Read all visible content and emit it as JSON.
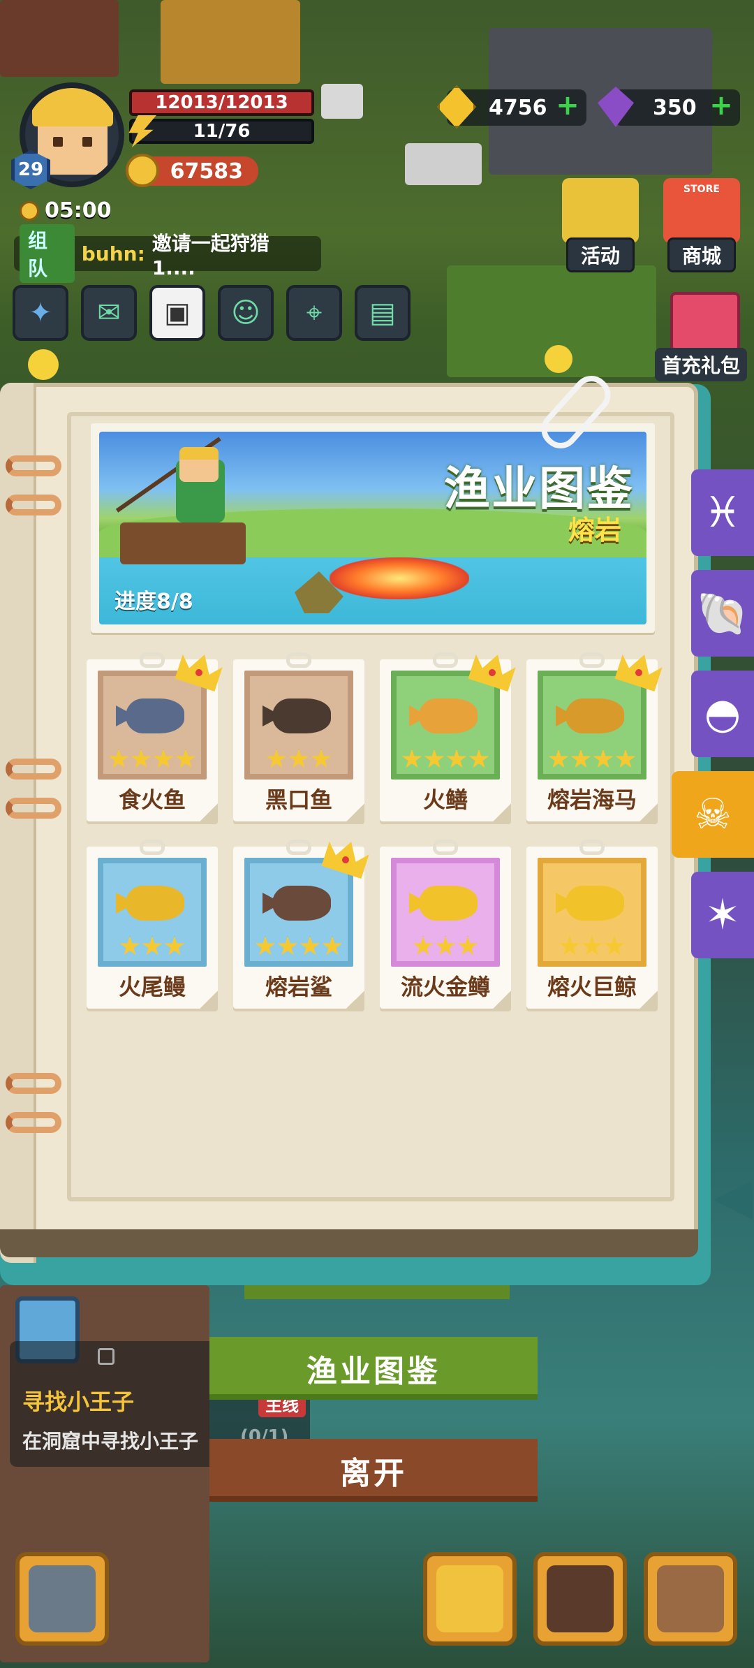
{
  "player": {
    "level": "29",
    "hp": "12013/12013",
    "energy": "11/76",
    "coins": "67583",
    "time": "05:00"
  },
  "chat": {
    "channel": "组队",
    "sender": "buhn:",
    "message": "邀请一起狩猎 1...."
  },
  "resources": {
    "gold": "4756",
    "gems": "350"
  },
  "shortcuts": {
    "activity": "活动",
    "store": "商城",
    "store_sign": "STORE",
    "gift": "首充礼包"
  },
  "banner": {
    "title": "渔业图鉴",
    "subtitle": "熔岩",
    "progress": "进度8/8"
  },
  "fish": [
    {
      "name": "食火鱼",
      "stars": 4,
      "crown": true,
      "tile": "#d9b99a",
      "border": "#c29a7a",
      "fish_color": "#5a6a8a"
    },
    {
      "name": "黑口鱼",
      "stars": 3,
      "crown": false,
      "tile": "#d9b99a",
      "border": "#c29a7a",
      "fish_color": "#4a3a30"
    },
    {
      "name": "火鳝",
      "stars": 4,
      "crown": true,
      "tile": "#8fd07a",
      "border": "#6aae55",
      "fish_color": "#e8a23a"
    },
    {
      "name": "熔岩海马",
      "stars": 4,
      "crown": true,
      "tile": "#8fd07a",
      "border": "#6aae55",
      "fish_color": "#d89a2a"
    },
    {
      "name": "火尾鳗",
      "stars": 3,
      "crown": false,
      "tile": "#8ecbe8",
      "border": "#6aaed0",
      "fish_color": "#e8b82a"
    },
    {
      "name": "熔岩鲨",
      "stars": 4,
      "crown": true,
      "tile": "#8ecbe8",
      "border": "#6aaed0",
      "fish_color": "#6a4a3a"
    },
    {
      "name": "流火金鳟",
      "stars": 3,
      "crown": false,
      "tile": "#e9b0ec",
      "border": "#d48ad8",
      "fish_color": "#f2c22a"
    },
    {
      "name": "熔火巨鲸",
      "stars": 3,
      "crown": false,
      "tile": "#f6c865",
      "border": "#e2a83a",
      "fish_color": "#f2c22a"
    }
  ],
  "tabs": [
    {
      "icon": "fish-icon",
      "glyph": "♓",
      "active": false
    },
    {
      "icon": "shell-icon",
      "glyph": "🐚",
      "active": false
    },
    {
      "icon": "clam-icon",
      "glyph": "◓",
      "active": false
    },
    {
      "icon": "skull-octopus-icon",
      "glyph": "☠",
      "active": true
    },
    {
      "icon": "starfish-icon",
      "glyph": "✶",
      "active": false
    }
  ],
  "buttons": {
    "codex": "渔业图鉴",
    "leave": "离开"
  },
  "quest": {
    "title": "寻找小王子",
    "description": "在洞窟中寻找小王子",
    "progress": "(0/1)",
    "tag": "主线"
  },
  "colors": {
    "accent_active_tab": "#f0a61a",
    "tab": "#7552c2",
    "card_name": "#6b3a1a"
  }
}
